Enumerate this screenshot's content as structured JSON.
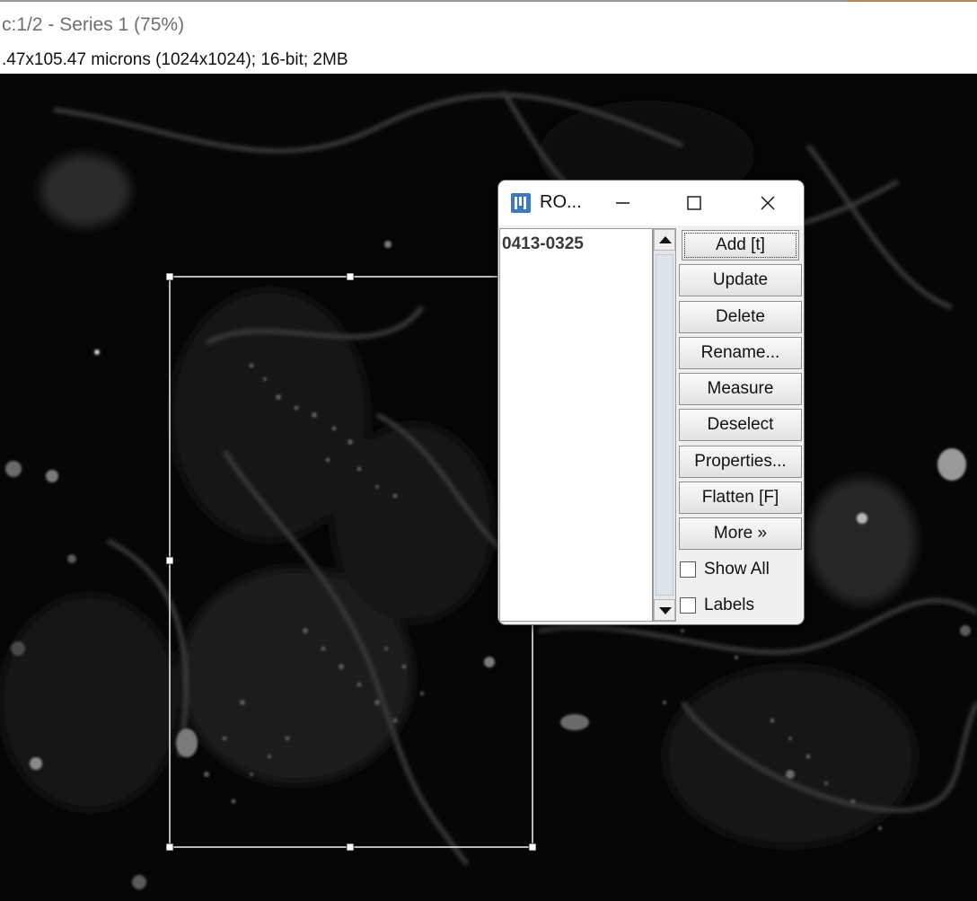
{
  "window": {
    "title": "c:1/2 - Series 1 (75%)",
    "info": ".47x105.47 microns (1024x1024); 16-bit; 2MB"
  },
  "roi_manager": {
    "title": "RO...",
    "list_items": [
      "0413-0325"
    ],
    "buttons": {
      "add": "Add [t]",
      "update": "Update",
      "delete": "Delete",
      "rename": "Rename...",
      "measure": "Measure",
      "deselect": "Deselect",
      "properties": "Properties...",
      "flatten": "Flatten [F]",
      "more": "More »"
    },
    "checkboxes": {
      "show_all": "Show All",
      "labels": "Labels"
    },
    "show_all_checked": false,
    "labels_checked": false
  },
  "colors": {
    "selection": "#e6e6e6",
    "logo": "#3d78c2",
    "image_background": "#070707"
  },
  "icons": [
    "imagej-logo-icon",
    "minimize-icon",
    "maximize-icon",
    "close-icon",
    "scroll-up-icon",
    "scroll-down-icon"
  ]
}
